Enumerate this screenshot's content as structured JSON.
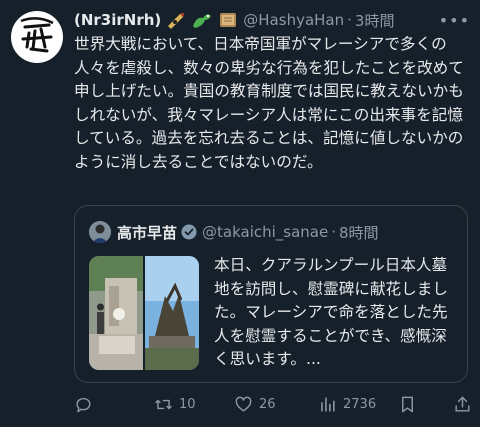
{
  "tweet": {
    "display_name": "(Nr3irNrh)",
    "emoji_icons": [
      "nuclear-missile-icon",
      "dragon-icon",
      "scroll-icon"
    ],
    "handle": "@HashyaHan",
    "separator": "·",
    "time": "3時間",
    "text": "世界大戦において、日本帝国軍がマレーシアで多くの人々を虐殺し、数々の卑劣な行為を犯したことを改めて申し上げたい。貴国の教育制度では国民に教えないかもしれないが、我々マレーシア人は常にこの出来事を記憶している。過去を忘れ去ることは、記憶に値しないかのように消し去ることではないのだ。"
  },
  "quote": {
    "display_name": "高市早苗",
    "handle": "@takaichi_sanae",
    "separator": "·",
    "time": "8時間",
    "text": "本日、クアラルンプール日本人墓地を訪問し、慰霊碑に献花しました。マレーシアで命を落とした先人を慰霊することができ、感慨深く思います。..."
  },
  "actions": {
    "reply_count": "",
    "retweet_count": "10",
    "like_count": "26",
    "views_count": "2736"
  },
  "colors": {
    "background": "#15202b",
    "text": "#e7e9ea",
    "muted": "#8b98a5",
    "border": "#38444d",
    "verified": "#829aab"
  }
}
